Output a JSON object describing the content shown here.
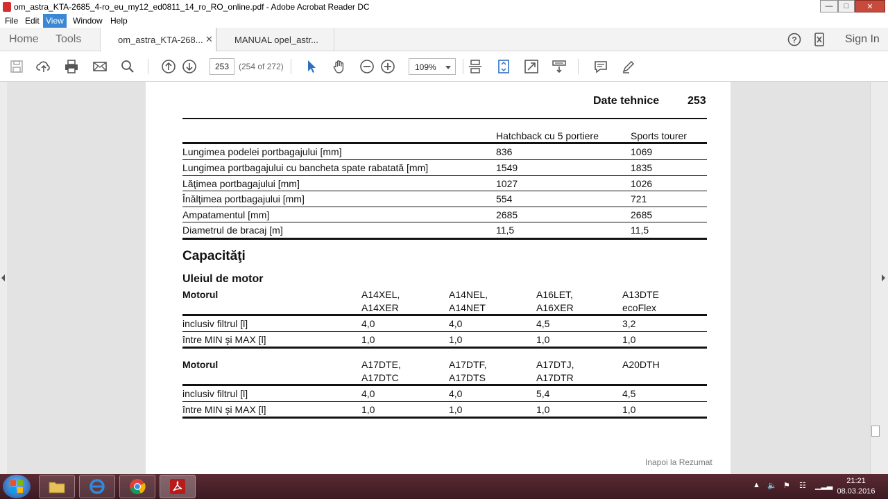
{
  "window": {
    "title": "om_astra_KTA-2685_4-ro_eu_my12_ed0811_14_ro_RO_online.pdf - Adobe Acrobat Reader DC"
  },
  "menu": [
    "File",
    "Edit",
    "View",
    "Window",
    "Help"
  ],
  "nav": {
    "home": "Home",
    "tools": "Tools"
  },
  "tabs": [
    {
      "label": "om_astra_KTA-268...",
      "active": true
    },
    {
      "label": "MANUAL opel_astr...",
      "active": false
    }
  ],
  "sign_in": "Sign In",
  "toolbar": {
    "page_number": "253",
    "page_count": "(254 of 272)",
    "zoom": "109%"
  },
  "page": {
    "header_title": "Date tehnice",
    "header_number": "253",
    "dimensions": {
      "columns": [
        "Hatchback cu 5 portiere",
        "Sports tourer"
      ],
      "rows": [
        {
          "label": "Lungimea podelei portbagajului [mm]",
          "values": [
            "836",
            "1069"
          ]
        },
        {
          "label": "Lungimea portbagajului cu bancheta spate rabatată [mm]",
          "values": [
            "1549",
            "1835"
          ]
        },
        {
          "label": "Lăţimea portbagajului [mm]",
          "values": [
            "1027",
            "1026"
          ]
        },
        {
          "label": "Înălţimea portbagajului [mm]",
          "values": [
            "554",
            "721"
          ]
        },
        {
          "label": "Ampatamentul [mm]",
          "values": [
            "2685",
            "2685"
          ]
        },
        {
          "label": "Diametrul de bracaj [m]",
          "values": [
            "11,5",
            "11,5"
          ]
        }
      ]
    },
    "section_title": "Capacităţi",
    "subsection_title": "Uleiul de motor",
    "oil_tables": [
      {
        "header": "Motorul",
        "engines": [
          [
            "A14XEL,",
            "A14XER"
          ],
          [
            "A14NEL,",
            "A14NET"
          ],
          [
            "A16LET,",
            "A16XER"
          ],
          [
            "A13DTE",
            "ecoFlex"
          ]
        ],
        "rows": [
          {
            "label": "inclusiv filtrul [l]",
            "values": [
              "4,0",
              "4,0",
              "4,5",
              "3,2"
            ]
          },
          {
            "label": "între MIN şi MAX [l]",
            "values": [
              "1,0",
              "1,0",
              "1,0",
              "1,0"
            ]
          }
        ]
      },
      {
        "header": "Motorul",
        "engines": [
          [
            "A17DTE,",
            "A17DTC"
          ],
          [
            "A17DTF,",
            "A17DTS"
          ],
          [
            "A17DTJ,",
            "A17DTR"
          ],
          [
            "A20DTH",
            ""
          ]
        ],
        "rows": [
          {
            "label": "inclusiv filtrul [l]",
            "values": [
              "4,0",
              "4,0",
              "5,4",
              "4,5"
            ]
          },
          {
            "label": "între MIN şi MAX [l]",
            "values": [
              "1,0",
              "1,0",
              "1,0",
              "1,0"
            ]
          }
        ]
      }
    ],
    "footer_link": "Inapoi la Rezumat"
  },
  "taskbar": {
    "time": "21:21",
    "date": "08.03.2016"
  }
}
